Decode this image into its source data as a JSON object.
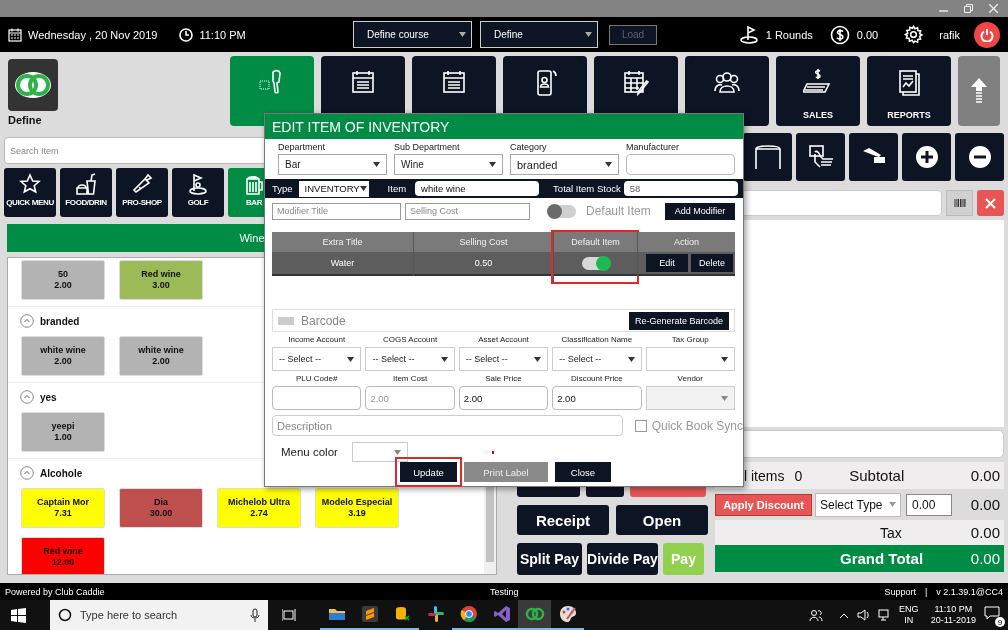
{
  "top_bar": {
    "date": "Wednesday , 20 Nov 2019",
    "time": "11:10 PM",
    "course_select": "Define course",
    "define_select": "Define",
    "load_button": {
      "label": "Load",
      "disabled": true
    },
    "rounds": "1 Rounds",
    "balance": "0.00",
    "user": "rafik"
  },
  "header": {
    "logo_label": "Define",
    "nav": [
      {
        "selected": true
      },
      {
        "selected": false
      },
      {
        "selected": false
      },
      {
        "selected": false
      },
      {
        "selected": false
      },
      {
        "selected": false
      },
      {
        "label": "SALES",
        "selected": false
      },
      {
        "label": "REPORTS",
        "selected": false
      }
    ]
  },
  "left_panel": {
    "search": {
      "placeholder": "Search Item"
    },
    "categories": [
      {
        "label": "QUICK MENU",
        "selected": false
      },
      {
        "label": "FOOD/DRIN",
        "selected": false
      },
      {
        "label": "PRO-SHOP",
        "selected": false
      },
      {
        "label": "GOLF",
        "selected": false
      },
      {
        "label": "BAR",
        "selected": true
      }
    ],
    "subheader": "Wine",
    "groups": [
      {
        "items": [
          {
            "name": "50",
            "price": "2.00",
            "color": "#b3b3b3"
          },
          {
            "name": "Red wine",
            "price": "3.00",
            "color": "#9bbb59"
          }
        ]
      },
      {
        "title": "branded",
        "expanded": true,
        "items": [
          {
            "name": "white wine",
            "price": "2.00",
            "color": "#b3b3b3"
          },
          {
            "name": "white wine",
            "price": "2.00",
            "color": "#b3b3b3"
          }
        ]
      },
      {
        "title": "yes",
        "expanded": true,
        "items": [
          {
            "name": "yeepi",
            "price": "1.00",
            "color": "#b3b3b3"
          }
        ]
      },
      {
        "title": "Alcohole",
        "expanded": true,
        "items": [
          {
            "name": "Captain Mor",
            "price": "7.31",
            "color": "#ffff00"
          },
          {
            "name": "Dia",
            "price": "30.00",
            "color": "#c0504d"
          },
          {
            "name": "Michelob Ultra",
            "price": "2.74",
            "color": "#ffff00"
          },
          {
            "name": "Modelo Especial",
            "price": "3.19",
            "color": "#ffff00"
          },
          {
            "name": "Red wine",
            "price": "12.00",
            "color": "#ff0000"
          }
        ]
      }
    ]
  },
  "right_panel": {
    "covered_buttons": [
      {
        "kind": "dark"
      },
      {
        "kind": "dark"
      },
      {
        "kind": "danger"
      }
    ],
    "buttons": [
      {
        "label": "Receipt",
        "kind": "dark"
      },
      {
        "label": "Open",
        "kind": "dark"
      },
      {
        "label": "Split Pay",
        "kind": "dark"
      },
      {
        "label": "Divide Pay",
        "kind": "dark"
      },
      {
        "label": "Pay",
        "kind": "confirm"
      }
    ],
    "totals": {
      "items_label": "l items",
      "items_count": "0",
      "subtotal_label": "Subtotal",
      "subtotal": "0.00",
      "discount_button": "Apply Discount",
      "discount_type": "Select Type",
      "discount_value": "0.00",
      "discount": "0.00",
      "tax_label": "Tax",
      "tax": "0.00",
      "grand_total_label": "Grand Total",
      "grand_total": "0.00"
    }
  },
  "modal": {
    "title": "EDIT ITEM OF INVENTORY",
    "top_fields": [
      {
        "label": "Department",
        "value": "Bar",
        "kind": "select"
      },
      {
        "label": "Sub Department",
        "value": "Wine",
        "kind": "select"
      },
      {
        "label": "Category",
        "value": "branded",
        "kind": "select"
      },
      {
        "label": "Manufacturer",
        "kind": "text"
      }
    ],
    "type_label": "Type",
    "type_value": "INVENTORY",
    "item_label": "Item",
    "item_value": "white wine",
    "stock_label": "Total Item Stock",
    "stock_value": "58",
    "modifier": {
      "title_placeholder": "Modifier Title",
      "cost_placeholder": "Selling Cost",
      "default_on": false,
      "default_label": "Default Item",
      "add_button": "Add Modifier"
    },
    "modifier_table": {
      "columns": [
        {
          "label": "Extra Title",
          "highlighted": false
        },
        {
          "label": "Selling Cost",
          "highlighted": false
        },
        {
          "label": "Default Item",
          "highlighted": true
        },
        {
          "label": "Action",
          "highlighted": false
        }
      ],
      "rows": [
        {
          "title": "Water",
          "cost": "0.50",
          "default": true,
          "edit": "Edit",
          "delete": "Delete"
        }
      ]
    },
    "barcode": {
      "placeholder": "Barcode",
      "button": "Re-Generate Barcode"
    },
    "accounts": [
      {
        "label": "Income Account",
        "value": "-- Select --",
        "kind": "select"
      },
      {
        "label": "COGS Account",
        "value": "-- Select --",
        "kind": "select"
      },
      {
        "label": "Asset Account",
        "value": "-- Select --",
        "kind": "select"
      },
      {
        "label": "Classification Name",
        "value": "-- Select --",
        "kind": "select"
      },
      {
        "label": "Tax Group",
        "kind": "select"
      }
    ],
    "prices": [
      {
        "label": "PLU Code#",
        "kind": "input"
      },
      {
        "label": "Item Cost",
        "placeholder": "2.00",
        "kind": "input"
      },
      {
        "label": "Sale Price",
        "value": "2.00",
        "kind": "input"
      },
      {
        "label": "Discount Price",
        "value": "2.00",
        "kind": "input"
      },
      {
        "label": "Vendor",
        "kind": "select"
      }
    ],
    "description_placeholder": "Description",
    "quick_book_sync": {
      "label": "Quick Book Sync",
      "checked": false
    },
    "menu_color_label": "Menu color",
    "buttons": [
      {
        "label": "Update",
        "kind": "primary",
        "highlighted": true
      },
      {
        "label": "Print Label",
        "kind": "secondary",
        "highlighted": false
      },
      {
        "label": "Close",
        "kind": "primary",
        "highlighted": false
      }
    ]
  },
  "status_bar": {
    "left": "Powered by Club Caddie",
    "center": "Testing",
    "support_link": "Support",
    "separator": "|",
    "version": "v 2.1.39.1@CC4"
  },
  "taskbar": {
    "search_placeholder": "Type here to search",
    "apps": [
      {
        "running": true,
        "selected": false
      },
      {
        "running": true,
        "selected": false
      },
      {
        "running": true,
        "selected": false
      },
      {
        "running": false,
        "selected": false
      },
      {
        "running": true,
        "selected": false
      },
      {
        "running": true,
        "selected": false
      },
      {
        "running": true,
        "selected": true
      },
      {
        "running": true,
        "selected": false
      }
    ],
    "language": "ENG",
    "region": "IN",
    "time": "11:10 PM",
    "date": "20-11-2019",
    "notifications": "9"
  }
}
